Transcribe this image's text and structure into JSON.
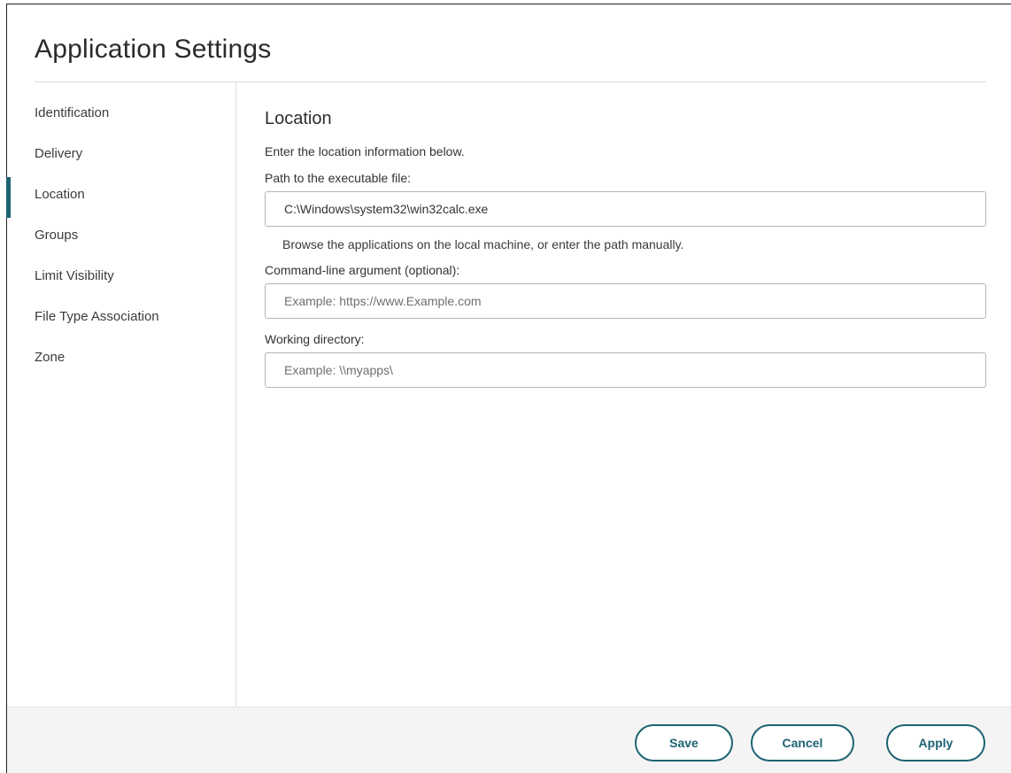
{
  "dialog": {
    "title": "Application Settings"
  },
  "sidebar": {
    "items": [
      {
        "label": "Identification",
        "active": false
      },
      {
        "label": "Delivery",
        "active": false
      },
      {
        "label": "Location",
        "active": true
      },
      {
        "label": "Groups",
        "active": false
      },
      {
        "label": "Limit Visibility",
        "active": false
      },
      {
        "label": "File Type Association",
        "active": false
      },
      {
        "label": "Zone",
        "active": false
      }
    ]
  },
  "location": {
    "section_title": "Location",
    "intro": "Enter the location information below.",
    "path_label": "Path to the executable file:",
    "path_value": "C:\\Windows\\system32\\win32calc.exe",
    "path_hint": "Browse the applications on the local machine, or enter the path manually.",
    "args_label": "Command-line argument (optional):",
    "args_placeholder": "Example: https://www.Example.com",
    "workdir_label": "Working directory:",
    "workdir_placeholder": "Example: \\\\myapps\\"
  },
  "footer": {
    "save_label": "Save",
    "cancel_label": "Cancel",
    "apply_label": "Apply"
  },
  "colors": {
    "accent": "#1d6373",
    "footer_bg": "#f4f4f4",
    "border": "#b5b5b5"
  }
}
